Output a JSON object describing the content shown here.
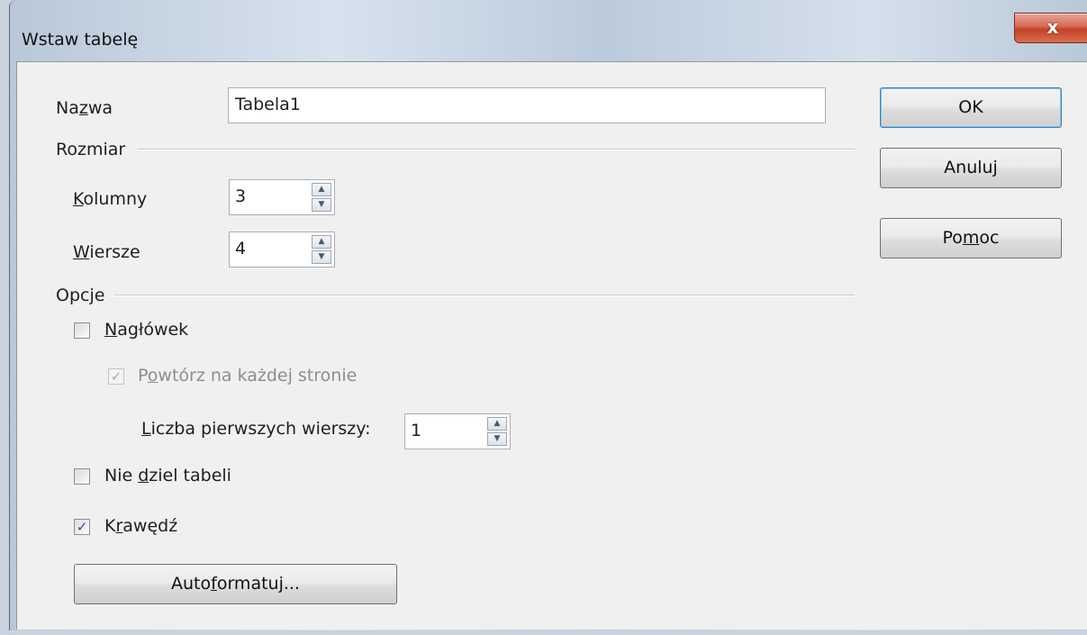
{
  "dialog": {
    "title": "Wstaw tabelę",
    "close_glyph": "x"
  },
  "name": {
    "label_pre": "Na",
    "label_key": "z",
    "label_post": "wa",
    "value": "Tabela1"
  },
  "size": {
    "section_label": "Rozmiar",
    "columns": {
      "label_key": "K",
      "label_post": "olumny",
      "value": "3"
    },
    "rows": {
      "label_key": "W",
      "label_post": "iersze",
      "value": "4"
    }
  },
  "options": {
    "section_label": "Opcje",
    "heading": {
      "label_key": "N",
      "label_post": "agłówek",
      "checked": false
    },
    "repeat": {
      "label_pre": "P",
      "label_key": "o",
      "label_post": "wtórz na każdej stronie",
      "checked": true,
      "enabled": false,
      "check_glyph": "✓"
    },
    "first_rows": {
      "label_key": "L",
      "label_post": "iczba pierwszych wierszy:",
      "value": "1"
    },
    "dont_split": {
      "label_pre": "Nie ",
      "label_key": "d",
      "label_post": "ziel tabeli",
      "checked": false
    },
    "border": {
      "label_pre": "K",
      "label_key": "r",
      "label_post": "awędź",
      "checked": true,
      "check_glyph": "✓"
    },
    "autoformat": {
      "label_pre": "Auto",
      "label_key": "f",
      "label_post": "ormatuj..."
    }
  },
  "buttons": {
    "ok": "OK",
    "cancel": "Anuluj",
    "help_pre": "Po",
    "help_key": "m",
    "help_post": "oc"
  },
  "spin_glyphs": {
    "up": "▲",
    "down": "▼"
  }
}
